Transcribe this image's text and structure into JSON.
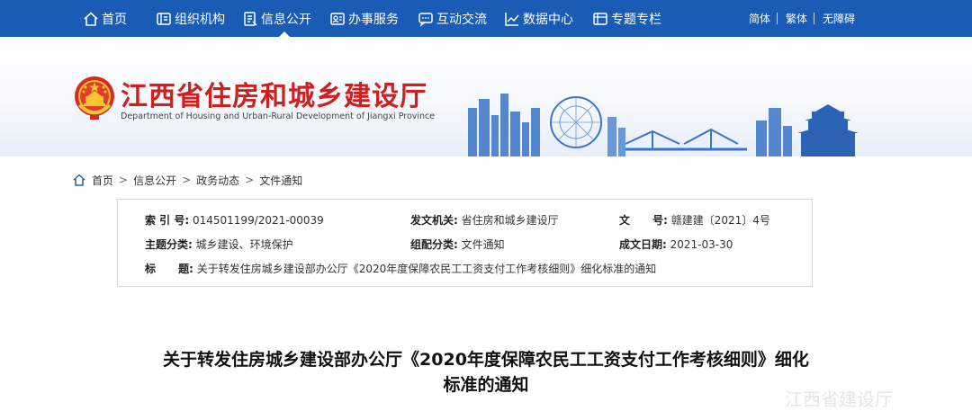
{
  "nav": {
    "items": [
      {
        "label": "首页",
        "icon": "home-icon"
      },
      {
        "label": "组织机构",
        "icon": "org-icon"
      },
      {
        "label": "信息公开",
        "icon": "doc-icon"
      },
      {
        "label": "办事服务",
        "icon": "service-icon"
      },
      {
        "label": "互动交流",
        "icon": "chat-icon"
      },
      {
        "label": "数据中心",
        "icon": "chart-icon"
      },
      {
        "label": "专题专栏",
        "icon": "topic-icon"
      }
    ],
    "active": "信息公开",
    "lang": [
      "简体",
      "繁体",
      "无障碍"
    ]
  },
  "header": {
    "title": "江西省住房和城乡建设厅",
    "subtitle": "Department of Housing and Urban-Rural Development of Jiangxi Province"
  },
  "breadcrumb": [
    "首页",
    "信息公开",
    "政务动态",
    "文件通知"
  ],
  "info": {
    "index_label": "索 引 号:",
    "index_value": "014501199/2021-00039",
    "issuer_label": "发文机关:",
    "issuer_value": "省住房和城乡建设厅",
    "docno_label": "文      号:",
    "docno_value": "赣建建〔2021〕4号",
    "topic_label": "主题分类:",
    "topic_value": "城乡建设、环境保护",
    "group_label": "组配分类:",
    "group_value": "文件通知",
    "date_label": "成文日期:",
    "date_value": "2021-03-30",
    "title_label": "标      题:",
    "title_value": "关于转发住房城乡建设部办公厅《2020年度保障农民工工资支付工作考核细则》细化标准的通知"
  },
  "article": {
    "title_line1": "关于转发住房城乡建设部办公厅《2020年度保障农民工工资支付工作考核细则》细化",
    "title_line2": "标准的通知"
  },
  "watermark": "江西省建设厅",
  "colors": {
    "nav_bg": "#1a5bb5",
    "title_red": "#cf1f1f"
  }
}
